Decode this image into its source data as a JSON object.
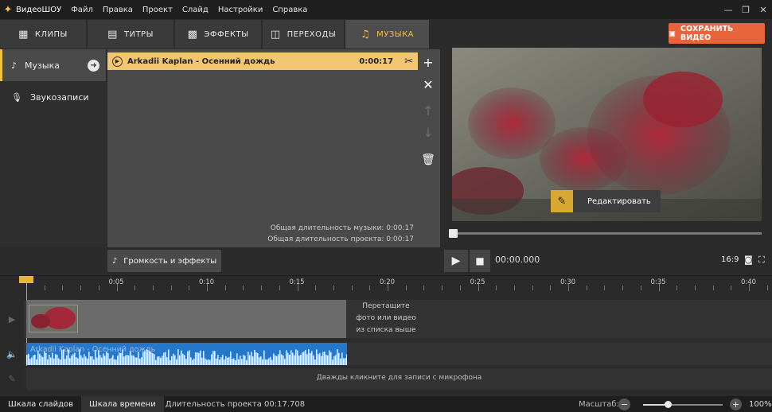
{
  "app": {
    "name": "ВидеоШОУ"
  },
  "menu": [
    "Файл",
    "Правка",
    "Проект",
    "Слайд",
    "Настройки",
    "Справка"
  ],
  "window_controls": {
    "minimize": "—",
    "restore": "❐",
    "close": "✕"
  },
  "tabs": [
    {
      "label": "КЛИПЫ",
      "icon": "film-icon",
      "active": false
    },
    {
      "label": "ТИТРЫ",
      "icon": "text-bubble-icon",
      "active": false
    },
    {
      "label": "ЭФФЕКТЫ",
      "icon": "effects-icon",
      "active": false
    },
    {
      "label": "ПЕРЕХОДЫ",
      "icon": "transition-icon",
      "active": false
    },
    {
      "label": "МУЗЫКА",
      "icon": "music-note-icon",
      "active": true
    }
  ],
  "save_button": "СОХРАНИТЬ ВИДЕО",
  "left_panel": {
    "items": [
      {
        "label": "Музыка",
        "icon": "music-file-icon",
        "active": true
      },
      {
        "label": "Звукозаписи",
        "icon": "microphone-icon",
        "active": false
      }
    ]
  },
  "track": {
    "title": "Arkadii Kaplan - Осенний дождь",
    "duration": "0:00:17"
  },
  "totals": {
    "music": "Общая длительность музыки: 0:00:17",
    "project": "Общая длительность проекта: 0:00:17"
  },
  "preview": {
    "edit_button": "Редактировать",
    "timecode": "00:00.000",
    "aspect": "16:9"
  },
  "volume_button": "Громкость и эффекты",
  "ruler": {
    "labels": [
      "0:05",
      "0:10",
      "0:15",
      "0:20",
      "0:25",
      "0:30",
      "0:35",
      "0:40"
    ]
  },
  "timeline": {
    "drop_hint": [
      "Перетащите",
      "фото или видео",
      "из списка выше"
    ],
    "audio_label": "Arkadii Kaplan - Осенний дождь",
    "mic_hint": "Дважды кликните для записи с микрофона"
  },
  "statusbar": {
    "tab_slides": "Шкала слайдов",
    "tab_timeline": "Шкала времени",
    "duration": "Длительность проекта 00:17.708",
    "zoom_label": "Масштаб:",
    "zoom_value": "100%",
    "zoom_fraction": 0.3
  },
  "colors": {
    "accent": "#f0c040",
    "save": "#e8643a",
    "audio": "#2577c9",
    "track": "#f2c670"
  }
}
